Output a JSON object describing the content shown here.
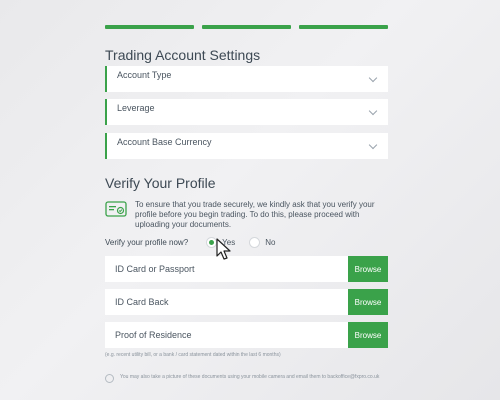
{
  "progress": {
    "steps": 3,
    "completed": 3,
    "color": "#3aa24a"
  },
  "trading": {
    "title": "Trading Account Settings",
    "fields": [
      {
        "label": "Account Type"
      },
      {
        "label": "Leverage"
      },
      {
        "label": "Account Base Currency"
      }
    ]
  },
  "verify": {
    "title": "Verify Your Profile",
    "info_text": "To ensure that you trade securely, we kindly ask that you verify your profile before you begin trading. To do this, please proceed with uploading your documents.",
    "question": "Verify your profile now?",
    "options": [
      {
        "label": "Yes",
        "selected": true
      },
      {
        "label": "No",
        "selected": false
      }
    ],
    "uploads": [
      {
        "label": "ID Card or Passport",
        "button": "Browse"
      },
      {
        "label": "ID Card Back",
        "button": "Browse"
      },
      {
        "label": "Proof of Residence",
        "button": "Browse"
      }
    ],
    "hint": "(e.g. recent utility bill, or a bank / card statement dated within the last 6 months)",
    "note": "You may also take a picture of these documents using your mobile camera and email them to backoffice@fxpro.co.uk"
  },
  "colors": {
    "accent": "#3aa24a",
    "text": "#3d4954"
  }
}
